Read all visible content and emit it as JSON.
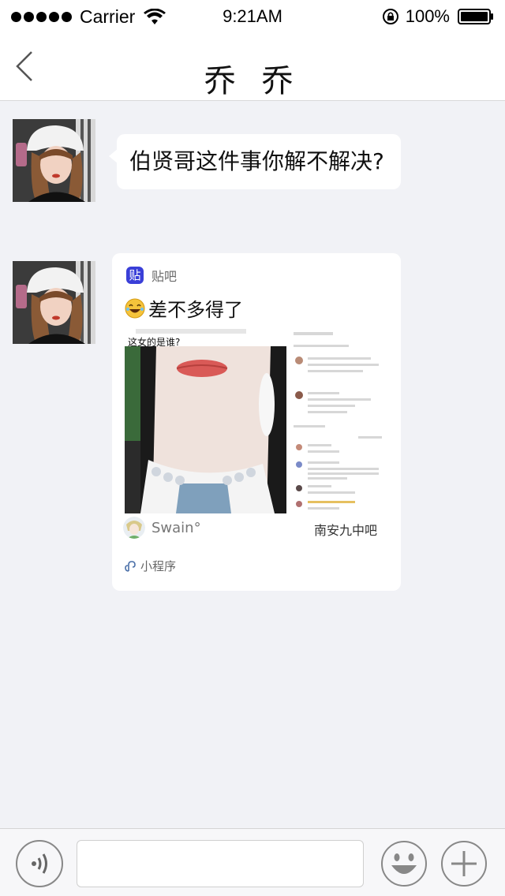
{
  "status_bar": {
    "carrier": "Carrier",
    "time": "9:21AM",
    "battery": "100%"
  },
  "nav": {
    "title": "乔 乔"
  },
  "messages": [
    {
      "type": "text",
      "text": "伯贤哥这件事你解不解决?"
    },
    {
      "type": "mini_program_card",
      "app_name": "贴吧",
      "app_icon_text": "贴",
      "title": "差不多得了",
      "thumbnail_caption": "这女的是谁?",
      "author": "Swain°",
      "forum": "南安九中吧",
      "footer_label": "小程序"
    }
  ],
  "input": {
    "value": "",
    "placeholder": ""
  },
  "colors": {
    "background": "#f1f2f6",
    "bubble": "#ffffff",
    "tieba_brand": "#3a3fd8"
  }
}
